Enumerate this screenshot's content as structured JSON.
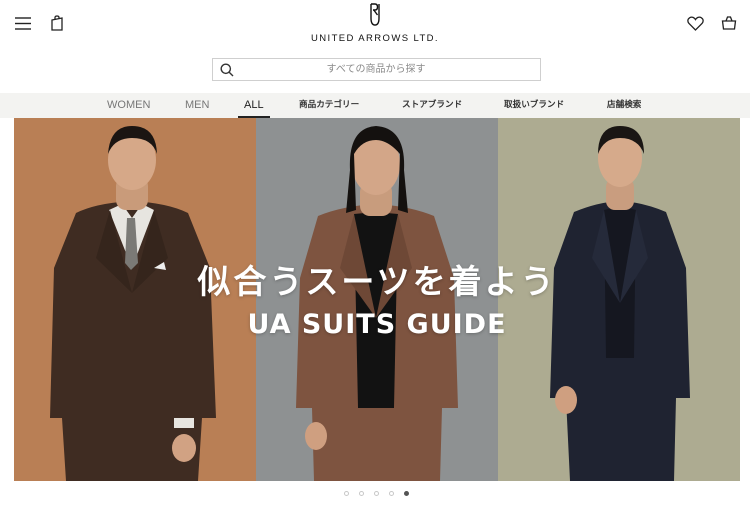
{
  "header": {
    "logo_text": "UNITED ARROWS LTD.",
    "icons": [
      "menu-icon",
      "shopping-bag-icon",
      "heart-icon",
      "cart-icon"
    ]
  },
  "search": {
    "placeholder": "すべての商品から探す"
  },
  "nav": {
    "items": [
      {
        "label": "WOMEN",
        "active": false
      },
      {
        "label": "MEN",
        "active": false
      },
      {
        "label": "ALL",
        "active": true
      },
      {
        "label": "商品カテゴリー",
        "active": false
      },
      {
        "label": "ストアブランド",
        "active": false
      },
      {
        "label": "取扱いブランド",
        "active": false
      },
      {
        "label": "店舗検索",
        "active": false
      }
    ]
  },
  "hero": {
    "title": "似合うスーツを着よう",
    "subtitle": "UA SUITS GUIDE",
    "panel_colors": [
      "#b97f55",
      "#8e9192",
      "#adab91"
    ]
  },
  "carousel": {
    "slide_count": 5,
    "active_index": 4
  }
}
